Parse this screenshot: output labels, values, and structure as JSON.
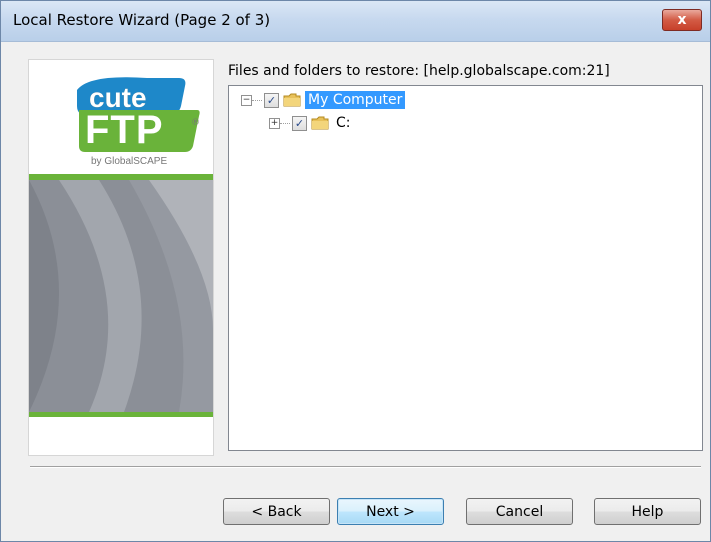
{
  "window": {
    "title": "Local Restore Wizard (Page 2 of 3)",
    "close_glyph": "x"
  },
  "banner": {
    "logo_line1": "cute",
    "logo_line2": "FTP",
    "logo_reg": "®",
    "logo_by": "by GlobalSCAPE"
  },
  "restore": {
    "label": "Files and folders to restore: [help.globalscape.com:21]",
    "tree": [
      {
        "label": "My Computer",
        "expander": "−",
        "checked": true,
        "selected": true
      },
      {
        "label": "C:",
        "expander": "+",
        "checked": true,
        "selected": false
      }
    ]
  },
  "buttons": {
    "back": "< Back",
    "next": "Next >",
    "cancel": "Cancel",
    "help": "Help"
  },
  "colors": {
    "accent_green": "#6ab33a",
    "logo_blue": "#1e88c9",
    "selection": "#3399ff"
  }
}
